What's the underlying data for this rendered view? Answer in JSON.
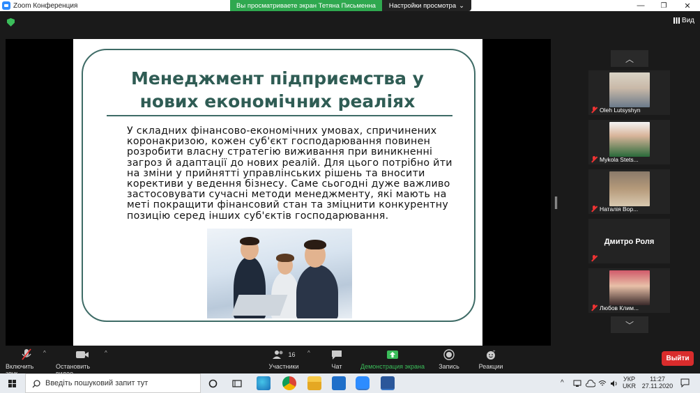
{
  "titlebar": {
    "app_title": "Zoom Конференция",
    "share_banner": "Вы просматриваете экран Тетяна Письменна",
    "view_options": "Настройки просмотра",
    "view_options_caret": "⌄",
    "minimize": "—",
    "maximize": "❐",
    "close": "✕"
  },
  "meeting": {
    "view_label": "Вид"
  },
  "slide": {
    "title": "Менеджмент підприємства у нових економічних реаліях",
    "body": "У складних фінансово-економічних умовах, спричинених коронакризою, кожен суб'єкт господарювання повинен розробити власну стратегію виживання при виникненні загроз й адаптації до нових реалій. Для цього потрібно йти на зміни у прийнятті управлінських рішень та вносити корективи у ведення бізнесу. Саме сьогодні дуже важливо застосовувати сучасні методи менеджменту, які мають на меті покращити фінансовий стан та зміцнити конкурентну позицію серед інших суб'єктів господарювання."
  },
  "participants_panel": {
    "scroll_up": "︿",
    "scroll_down": "﹀",
    "tiles": [
      {
        "name": "Oleh Lutsyshyn",
        "photo_color": "#c9b9a8"
      },
      {
        "name": "Mykola Stets...",
        "photo_color": "#a8c0d8"
      },
      {
        "name": "Наталія Вор...",
        "photo_color": "#b59a7a"
      },
      {
        "name": "Дмитро Роля",
        "photo_color": ""
      },
      {
        "name": "Любов Клим...",
        "photo_color": "#d8a89a"
      }
    ]
  },
  "toolbar": {
    "mute_label": "Включить звук",
    "video_label": "Остановить видео",
    "participants_label": "Участники",
    "participants_count": "16",
    "chat_label": "Чат",
    "share_label": "Демонстрация экрана",
    "record_label": "Запись",
    "reactions_label": "Реакции",
    "leave_label": "Выйти",
    "caret": "^"
  },
  "taskbar": {
    "search_placeholder": "Введіть пошуковий запит тут",
    "lang_top": "УКР",
    "lang_bottom": "UKR",
    "time": "11:27",
    "date": "27.11.2020"
  },
  "colors": {
    "share_banner": "#2fa84f",
    "slide_title": "#2f5c54",
    "share_green": "#3bbd5a",
    "leave_red": "#d92c2c"
  }
}
